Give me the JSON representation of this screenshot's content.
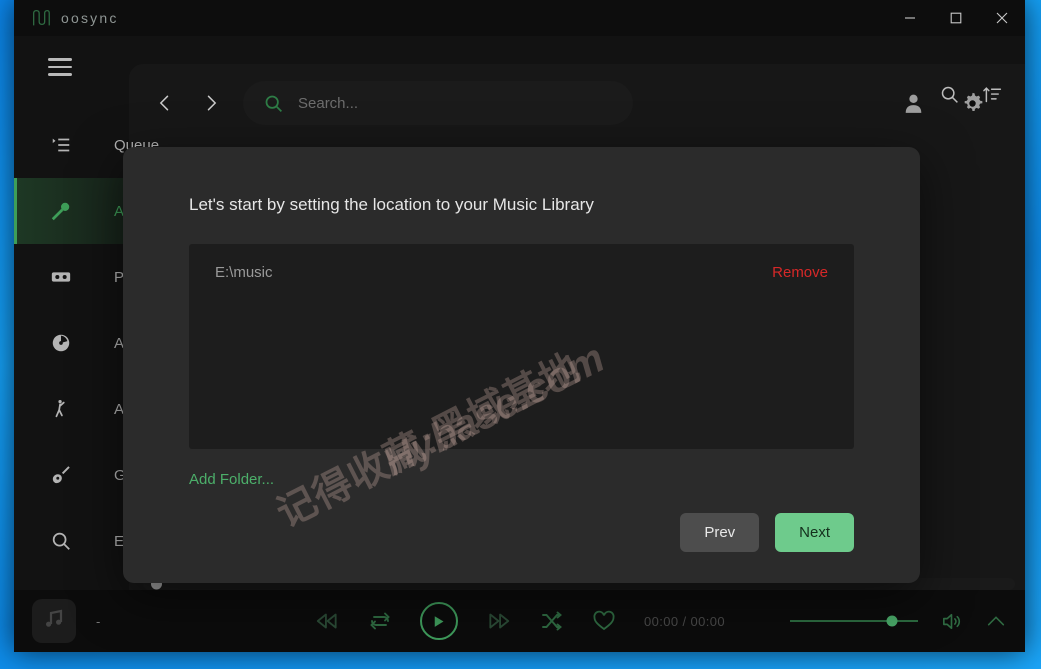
{
  "desktop": {
    "background_color": "#0f96f0"
  },
  "window": {
    "titlebar": {
      "brand": "oosync",
      "logo_icon": "m-logo-icon",
      "controls": [
        {
          "name": "minimize-button",
          "glyph": "minimize-icon"
        },
        {
          "name": "maximize-button",
          "glyph": "maximize-icon"
        },
        {
          "name": "close-button",
          "glyph": "close-icon"
        }
      ]
    }
  },
  "topnav": {
    "back_icon": "chevron-left-icon",
    "forward_icon": "chevron-right-icon",
    "search": {
      "icon": "search-icon",
      "value": "",
      "placeholder": "Search..."
    },
    "account_icon": "person-icon",
    "settings_icon": "gear-icon"
  },
  "sidebar": {
    "menu_icon": "hamburger-icon",
    "items": [
      {
        "label": "Queue",
        "icon": "queue-list-icon",
        "active": false
      },
      {
        "label": "Artists",
        "icon": "microphone-icon",
        "active": true
      },
      {
        "label": "Podcasts",
        "icon": "cassette-icon",
        "active": false
      },
      {
        "label": "Albums",
        "icon": "disc-icon",
        "active": false
      },
      {
        "label": "Artists",
        "icon": "dancer-icon",
        "active": false
      },
      {
        "label": "Genres",
        "icon": "guitar-icon",
        "active": false
      },
      {
        "label": "Explore",
        "icon": "search-icon",
        "active": false
      }
    ]
  },
  "main": {
    "title": "",
    "search_icon": "search-icon",
    "sort_icon": "sort-ascending-icon"
  },
  "modal": {
    "heading": "Let's start by setting the location to your Music Library",
    "folders": [
      {
        "path": "E:\\music",
        "remove_label": "Remove"
      }
    ],
    "add_folder_label": "Add Folder...",
    "prev_label": "Prev",
    "next_label": "Next",
    "accent_green": "#6ecb8c",
    "remove_red": "#d62828"
  },
  "player": {
    "album_art_icon": "music-note-icon",
    "track_title": "-",
    "controls": [
      {
        "name": "previous-button",
        "icon": "rewind-icon"
      },
      {
        "name": "repeat-button",
        "icon": "repeat-icon"
      },
      {
        "name": "play-button",
        "icon": "play-icon"
      },
      {
        "name": "next-button",
        "icon": "fast-forward-icon"
      },
      {
        "name": "shuffle-button",
        "icon": "shuffle-icon"
      },
      {
        "name": "favorite-button",
        "icon": "heart-icon"
      }
    ],
    "time_display": "00:00 / 00:00",
    "elapsed": "00:00",
    "duration": "00:00",
    "volume_percent": 80,
    "volume_icon": "speaker-icon",
    "expand_icon": "chevron-up-icon",
    "seek_percent": 0
  },
  "watermark": {
    "cn": "记得收藏:黑域基地",
    "en": "Hybase.com"
  }
}
